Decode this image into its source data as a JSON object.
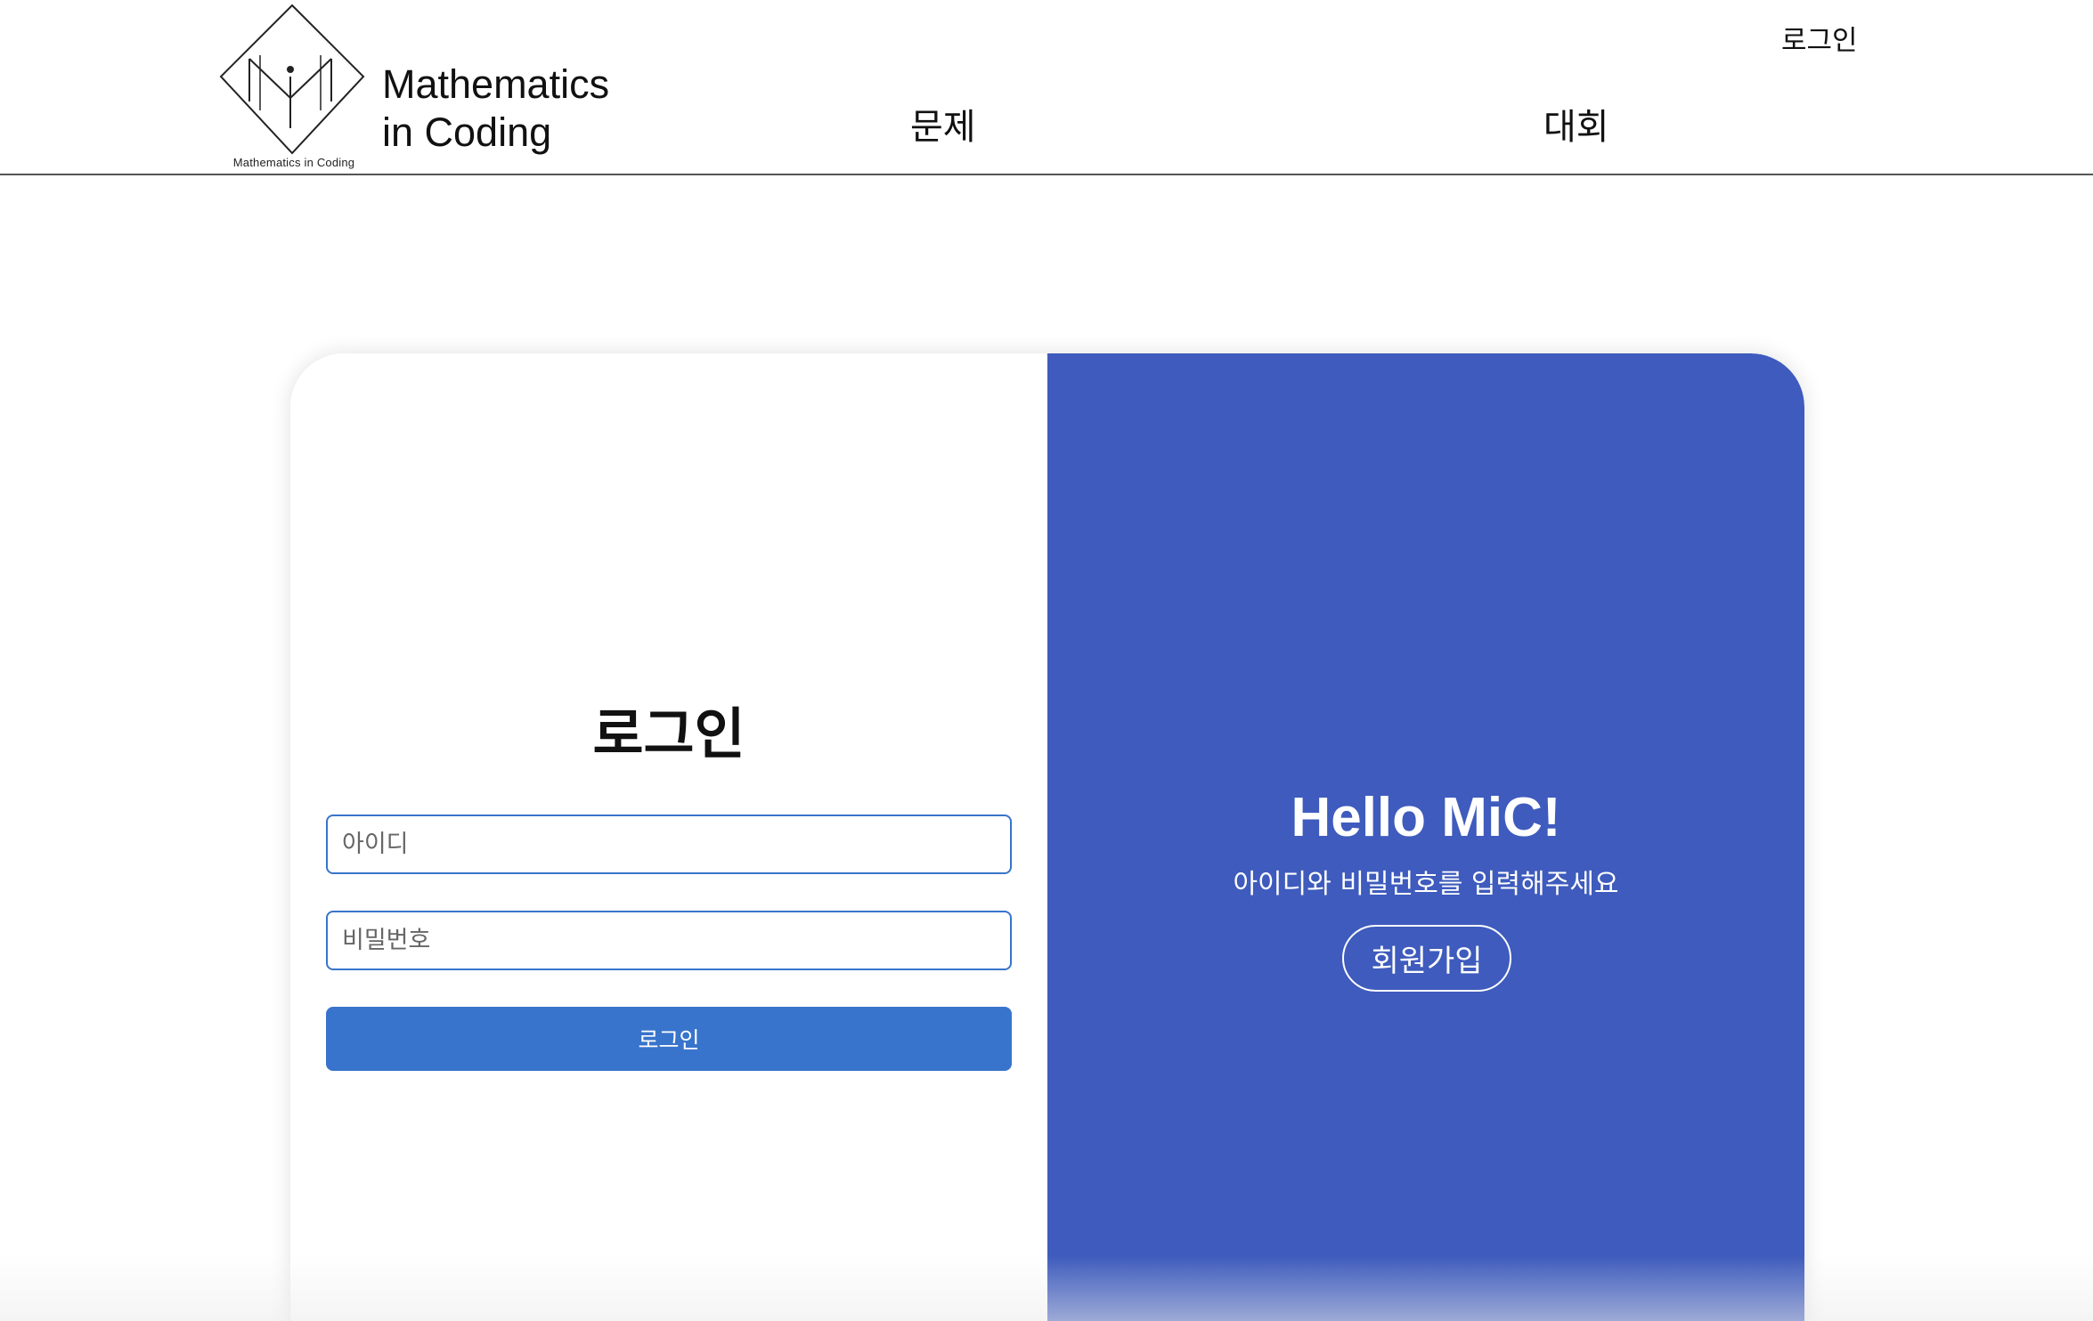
{
  "header": {
    "logo_caption": "Mathematics in Coding",
    "brand_line1": "Mathematics",
    "brand_line2": "in Coding",
    "nav": {
      "problems": "문제",
      "contest": "대회"
    },
    "login_link": "로그인"
  },
  "login_form": {
    "title": "로그인",
    "id_placeholder": "아이디",
    "id_value": "",
    "password_placeholder": "비밀번호",
    "password_value": "",
    "submit_label": "로그인"
  },
  "welcome": {
    "headline": "Hello MiC!",
    "subtitle": "아이디와 비밀번호를 입력해주세요",
    "signup_label": "회원가입"
  },
  "colors": {
    "accent_blue": "#3874cb",
    "panel_blue": "#3e5bbd",
    "header_rule": "#555555"
  }
}
